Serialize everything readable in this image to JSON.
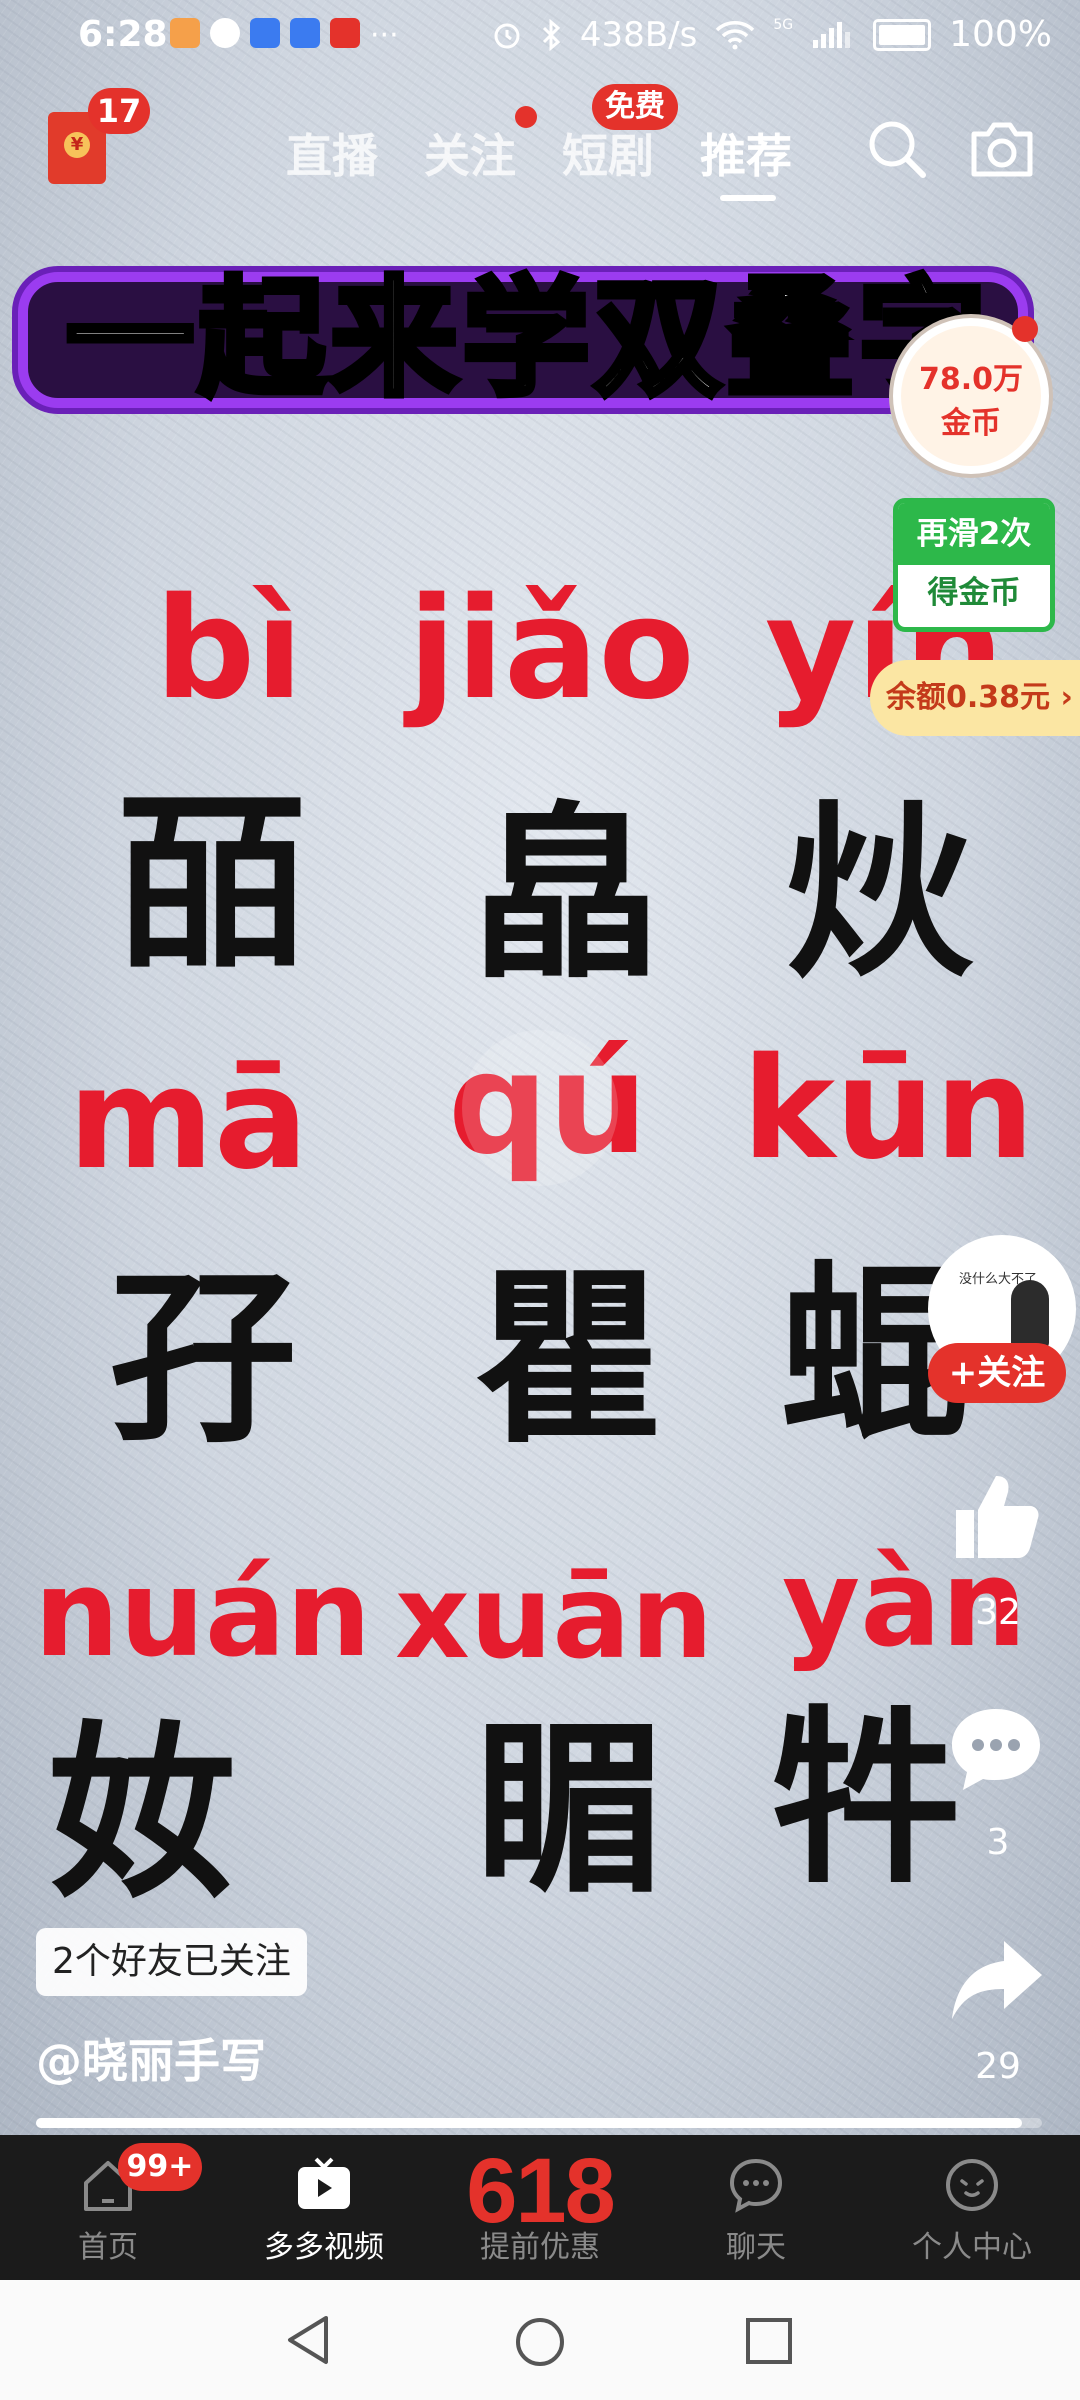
{
  "status_bar": {
    "time": "6:28",
    "more": "···",
    "speed": "438B/s",
    "signal_5g": "5G",
    "battery": "100%"
  },
  "top_nav": {
    "red_packet_count": "17",
    "tabs": [
      {
        "label": "直播"
      },
      {
        "label": "关注"
      },
      {
        "label": "短剧",
        "badge": "免费"
      },
      {
        "label": "推荐"
      }
    ]
  },
  "video": {
    "title": "一起来学双叠字",
    "rows": [
      {
        "pinyin": [
          "bì",
          "jiǎo",
          "yín"
        ],
        "hanzi": [
          "皕",
          "皛",
          "炏"
        ]
      },
      {
        "pinyin": [
          "mā",
          "qú",
          "kūn"
        ],
        "hanzi": [
          "孖",
          "瞿",
          "蜫"
        ]
      },
      {
        "pinyin": [
          "nuán",
          "xuān",
          "yàn"
        ],
        "hanzi": [
          "奻",
          "睸",
          "牪"
        ]
      }
    ]
  },
  "reward": {
    "coins_amount": "78.0万",
    "coins_unit": "金币",
    "swipe_line1": "再滑2次",
    "swipe_line2": "得金币",
    "balance": "余额0.38元",
    "balance_arrow": "›"
  },
  "creator": {
    "avatar_caption": "没什么大不了",
    "follow_label": "+关注",
    "friends_followed": "2个好友已关注",
    "handle": "@晓丽手写"
  },
  "actions": {
    "likes": "32",
    "comments": "3",
    "shares": "29"
  },
  "progress_fraction": 0.98,
  "bottom_nav": {
    "items": [
      {
        "label": "首页",
        "badge": "99+"
      },
      {
        "label": "多多视频"
      },
      {
        "label": "提前优惠",
        "big": "618"
      },
      {
        "label": "聊天"
      },
      {
        "label": "个人中心"
      }
    ]
  },
  "colors": {
    "accent_red": "#e4322b",
    "pinyin_red": "#e61c2e",
    "title_purple": "#9b3cf0",
    "coin_green": "#2db84a"
  }
}
